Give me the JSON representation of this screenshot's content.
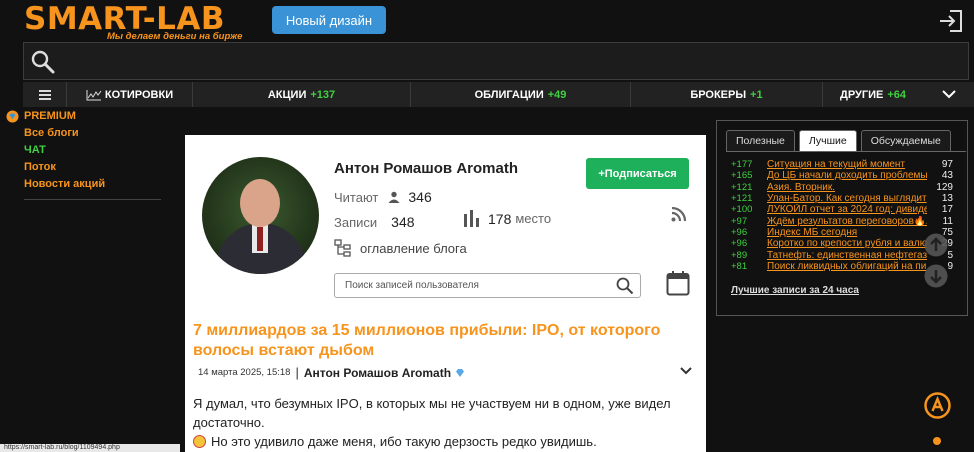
{
  "header": {
    "logo": "SMART-LAB",
    "tagline": "Мы делаем деньги на бирже",
    "new_design_label": "Новый дизайн"
  },
  "nav": {
    "quotes": "КОТИРОВКИ",
    "stocks": {
      "label": "АКЦИИ",
      "count": "+137"
    },
    "bonds": {
      "label": "ОБЛИГАЦИИ",
      "count": "+49"
    },
    "brokers": {
      "label": "БРОКЕРЫ",
      "count": "+1"
    },
    "others": {
      "label": "ДРУГИЕ",
      "count": "+64"
    }
  },
  "sidebar": {
    "items": [
      {
        "label": "PREMIUM"
      },
      {
        "label": "Все блоги"
      },
      {
        "label": "ЧАТ"
      },
      {
        "label": "Поток"
      },
      {
        "label": "Новости акций"
      }
    ]
  },
  "profile": {
    "name": "Антон Ромашов Aromath",
    "subscribe_label": "+Подписаться",
    "readers_label": "Читают",
    "readers_count": "346",
    "posts_label": "Записи",
    "posts_count": "348",
    "rank_value": "178",
    "rank_suffix": "место",
    "toc_label": "оглавление блога",
    "search_placeholder": "Поиск записей пользователя"
  },
  "post": {
    "title": "7 миллиардов за 15 миллионов прибыли: IPO, от которого волосы встают дыбом",
    "date": "14 марта 2025, 15:18",
    "separator": "|",
    "author": "Антон Ромашов Aromath",
    "paragraph1": "Я думал, что безумных IPO, в которых мы не участвуем ни в одном, уже видел достаточно.",
    "paragraph2": "Но это удивило даже меня, ибо такую дерзость редко увидишь."
  },
  "right_panel": {
    "tabs": [
      {
        "label": "Полезные"
      },
      {
        "label": "Лучшие"
      },
      {
        "label": "Обсуждаемые"
      }
    ],
    "rows": [
      {
        "score": "+177",
        "title": "Ситуация на текущий момент",
        "count": "97"
      },
      {
        "score": "+165",
        "title": "До ЦБ начали доходить проблемы",
        "count": "43"
      },
      {
        "score": "+121",
        "title": "Азия. Вторник.",
        "count": "129"
      },
      {
        "score": "+121",
        "title": "Улан-Батор. Как сегодня выглядит",
        "count": "13"
      },
      {
        "score": "+100",
        "title": "ЛУКОЙЛ отчет за 2024 год: дивиде",
        "count": "17"
      },
      {
        "score": "+97",
        "title": "Ждём результатов переговоров🔥А",
        "count": "11"
      },
      {
        "score": "+96",
        "title": "Индекс МБ сегодня",
        "count": "75"
      },
      {
        "score": "+96",
        "title": "Коротко по крепости рубля и валю",
        "count": "29"
      },
      {
        "score": "+89",
        "title": "Татнефть: единственная нефтегазо",
        "count": "5"
      },
      {
        "score": "+81",
        "title": "Поиск ликвидных облигаций на пи",
        "count": "9"
      }
    ],
    "best_24h": "Лучшие записи за 24 часа"
  },
  "status_bar": {
    "url": "https://smart-lab.ru/blog/1109494.php"
  },
  "colors": {
    "accent": "#f7941d",
    "green": "#3fd13f",
    "subscribe": "#1fb05b",
    "new_design": "#3a93d6"
  }
}
